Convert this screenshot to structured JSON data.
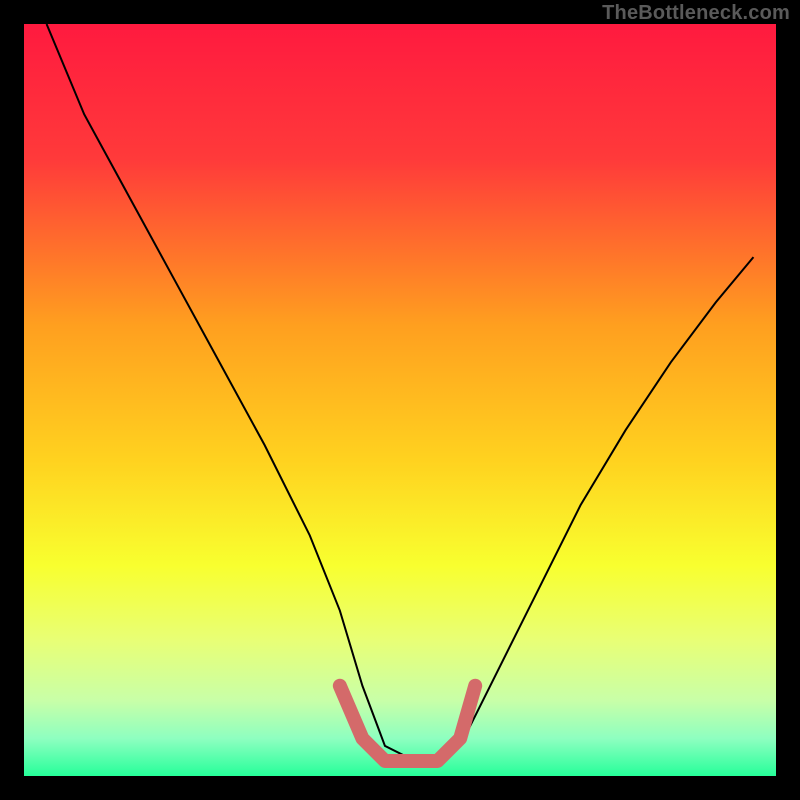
{
  "watermark": "TheBottleneck.com",
  "chart_data": {
    "type": "line",
    "title": "",
    "xlabel": "",
    "ylabel": "",
    "xlim": [
      0,
      100
    ],
    "ylim": [
      0,
      100
    ],
    "background_gradient": {
      "stops": [
        {
          "offset": 0,
          "color": "#ff1a3f"
        },
        {
          "offset": 18,
          "color": "#ff3a3a"
        },
        {
          "offset": 40,
          "color": "#ff9f1f"
        },
        {
          "offset": 58,
          "color": "#ffd21f"
        },
        {
          "offset": 72,
          "color": "#f8ff2f"
        },
        {
          "offset": 82,
          "color": "#e8ff76"
        },
        {
          "offset": 90,
          "color": "#c8ffa8"
        },
        {
          "offset": 95,
          "color": "#8effc0"
        },
        {
          "offset": 100,
          "color": "#26ff9a"
        }
      ]
    },
    "series": [
      {
        "name": "bottleneck-curve",
        "stroke": "#000000",
        "stroke_width": 2,
        "x": [
          3,
          8,
          14,
          20,
          26,
          32,
          38,
          42,
          45,
          48,
          52,
          55,
          58,
          62,
          68,
          74,
          80,
          86,
          92,
          97
        ],
        "y": [
          100,
          88,
          77,
          66,
          55,
          44,
          32,
          22,
          12,
          4,
          2,
          2,
          4,
          12,
          24,
          36,
          46,
          55,
          63,
          69
        ]
      },
      {
        "name": "optimal-zone-marker",
        "stroke": "#d46a6a",
        "stroke_width": 14,
        "linecap": "round",
        "x": [
          42,
          45,
          48,
          52,
          55,
          58,
          60
        ],
        "y": [
          12,
          5,
          2,
          2,
          2,
          5,
          12
        ]
      }
    ]
  }
}
